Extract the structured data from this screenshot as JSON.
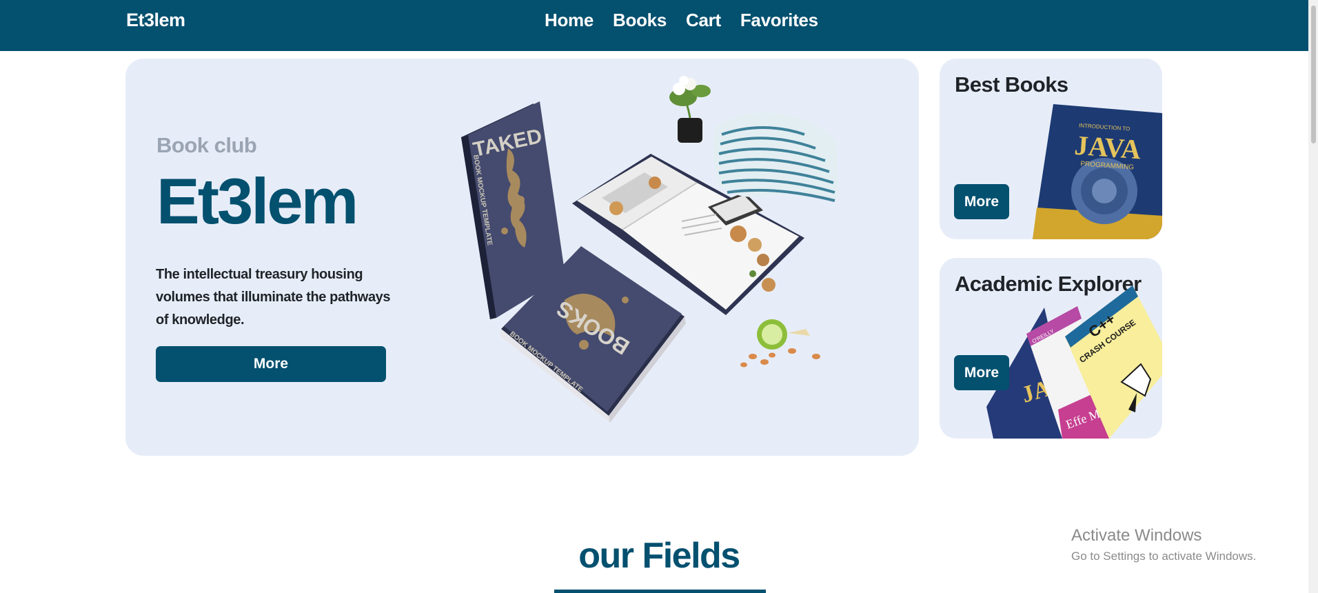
{
  "nav": {
    "brand": "Et3lem",
    "links": [
      "Home",
      "Books",
      "Cart",
      "Favorites"
    ]
  },
  "hero": {
    "subtitle": "Book club",
    "title": "Et3lem",
    "description": "The intellectual treasury housing volumes that illuminate the pathways of knowledge.",
    "button": "More",
    "illustration": {
      "book1_spine": "BOOK MOCKUP TEMPLATE",
      "book1_cover": "TAKED",
      "book2_cover": "BOOKS",
      "book2_spine": "BOOK MOCKUP TEMPLATE"
    }
  },
  "cards": [
    {
      "title": "Best Books",
      "button": "More",
      "art": {
        "top": "INTRODUCTION TO",
        "main": "JAVA",
        "sub": "PROGRAMMING"
      }
    },
    {
      "title": "Academic Explorer",
      "button": "More",
      "art": {
        "book_a": "JA",
        "book_b_label": "O'REILLY",
        "book_b": "Effe Mod",
        "book_c": "C++",
        "book_c_sub": "CRASH COURSE"
      }
    }
  ],
  "section": {
    "title": "our Fields"
  },
  "watermark": {
    "title": "Activate Windows",
    "subtitle": "Go to Settings to activate Windows."
  },
  "colors": {
    "primary": "#03506f",
    "card_bg": "#e7edf8",
    "book_dark": "#434a6d",
    "gold": "#c09a5b"
  }
}
